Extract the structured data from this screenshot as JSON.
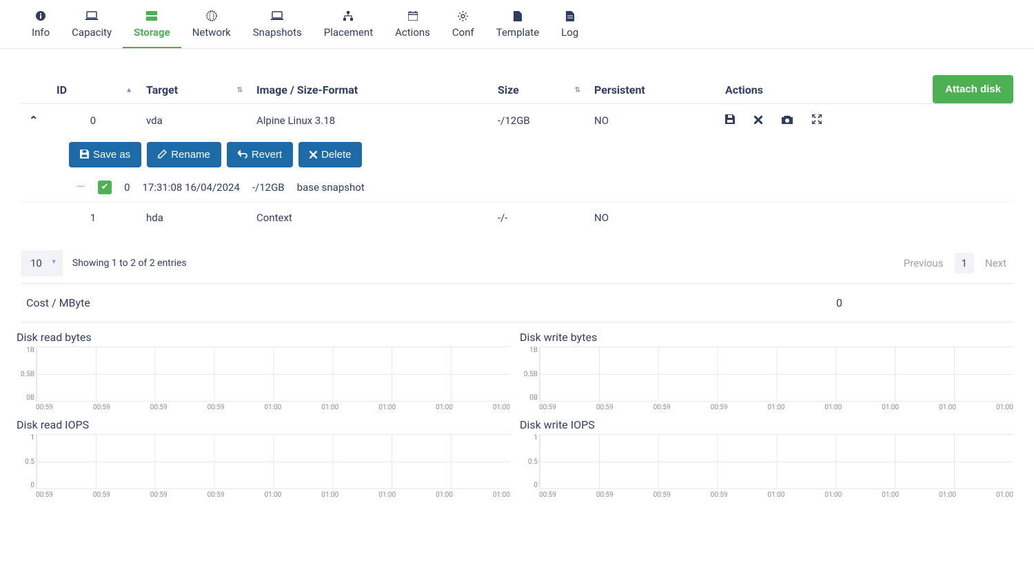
{
  "tabs": {
    "info": "Info",
    "capacity": "Capacity",
    "storage": "Storage",
    "network": "Network",
    "snapshots": "Snapshots",
    "placement": "Placement",
    "actions": "Actions",
    "conf": "Conf",
    "template": "Template",
    "log": "Log"
  },
  "table": {
    "headers": {
      "id": "ID",
      "target": "Target",
      "image": "Image / Size-Format",
      "size": "Size",
      "persistent": "Persistent",
      "actions": "Actions"
    },
    "attach_btn": "Attach disk",
    "rows": [
      {
        "id": "0",
        "target": "vda",
        "image": "Alpine Linux 3.18",
        "size": "-/12GB",
        "persistent": "NO"
      },
      {
        "id": "1",
        "target": "hda",
        "image": "Context",
        "size": "-/-",
        "persistent": "NO"
      }
    ],
    "row_buttons": {
      "save_as": "Save as",
      "rename": "Rename",
      "revert": "Revert",
      "delete": "Delete"
    },
    "snapshot": {
      "id": "0",
      "timestamp": "17:31:08 16/04/2024",
      "size": "-/12GB",
      "name": "base snapshot"
    }
  },
  "pagination": {
    "page_size": "10",
    "showing": "Showing 1 to 2 of 2 entries",
    "previous": "Previous",
    "current": "1",
    "next": "Next"
  },
  "cost": {
    "label": "Cost / MByte",
    "value": "0"
  },
  "chart_titles": {
    "read_bytes": "Disk read bytes",
    "write_bytes": "Disk write bytes",
    "read_iops": "Disk read IOPS",
    "write_iops": "Disk write IOPS"
  },
  "chart_data": [
    {
      "type": "line",
      "title": "Disk read bytes",
      "x": [
        "00:59",
        "00:59",
        "00:59",
        "00:59",
        "01:00",
        "01:00",
        "01:00",
        "01:00",
        "01:00"
      ],
      "y_ticks": [
        "1B",
        "0.5B",
        "0B"
      ],
      "series": [
        {
          "name": "read_bytes",
          "values": [
            0,
            0,
            0,
            0,
            0,
            0,
            0,
            0,
            0
          ]
        }
      ],
      "ylim": [
        0,
        1
      ]
    },
    {
      "type": "line",
      "title": "Disk write bytes",
      "x": [
        "00:59",
        "00:59",
        "00:59",
        "00:59",
        "01:00",
        "01:00",
        "01:00",
        "01:00",
        "01:00"
      ],
      "y_ticks": [
        "1B",
        "0.5B",
        "0B"
      ],
      "series": [
        {
          "name": "write_bytes",
          "values": [
            0,
            0,
            0,
            0,
            0,
            0,
            0,
            0,
            0
          ]
        }
      ],
      "ylim": [
        0,
        1
      ]
    },
    {
      "type": "line",
      "title": "Disk read IOPS",
      "x": [
        "00:59",
        "00:59",
        "00:59",
        "00:59",
        "01:00",
        "01:00",
        "01:00",
        "01:00",
        "01:00"
      ],
      "y_ticks": [
        "1",
        "0.5",
        "0"
      ],
      "series": [
        {
          "name": "read_iops",
          "values": [
            0,
            0,
            0,
            0,
            0,
            0,
            0,
            0,
            0
          ]
        }
      ],
      "ylim": [
        0,
        1
      ]
    },
    {
      "type": "line",
      "title": "Disk write IOPS",
      "x": [
        "00:59",
        "00:59",
        "00:59",
        "00:59",
        "01:00",
        "01:00",
        "01:00",
        "01:00",
        "01:00"
      ],
      "y_ticks": [
        "1",
        "0.5",
        "0"
      ],
      "series": [
        {
          "name": "write_iops",
          "values": [
            0,
            0,
            0,
            0,
            0,
            0,
            0,
            0,
            0
          ]
        }
      ],
      "ylim": [
        0,
        1
      ]
    }
  ]
}
